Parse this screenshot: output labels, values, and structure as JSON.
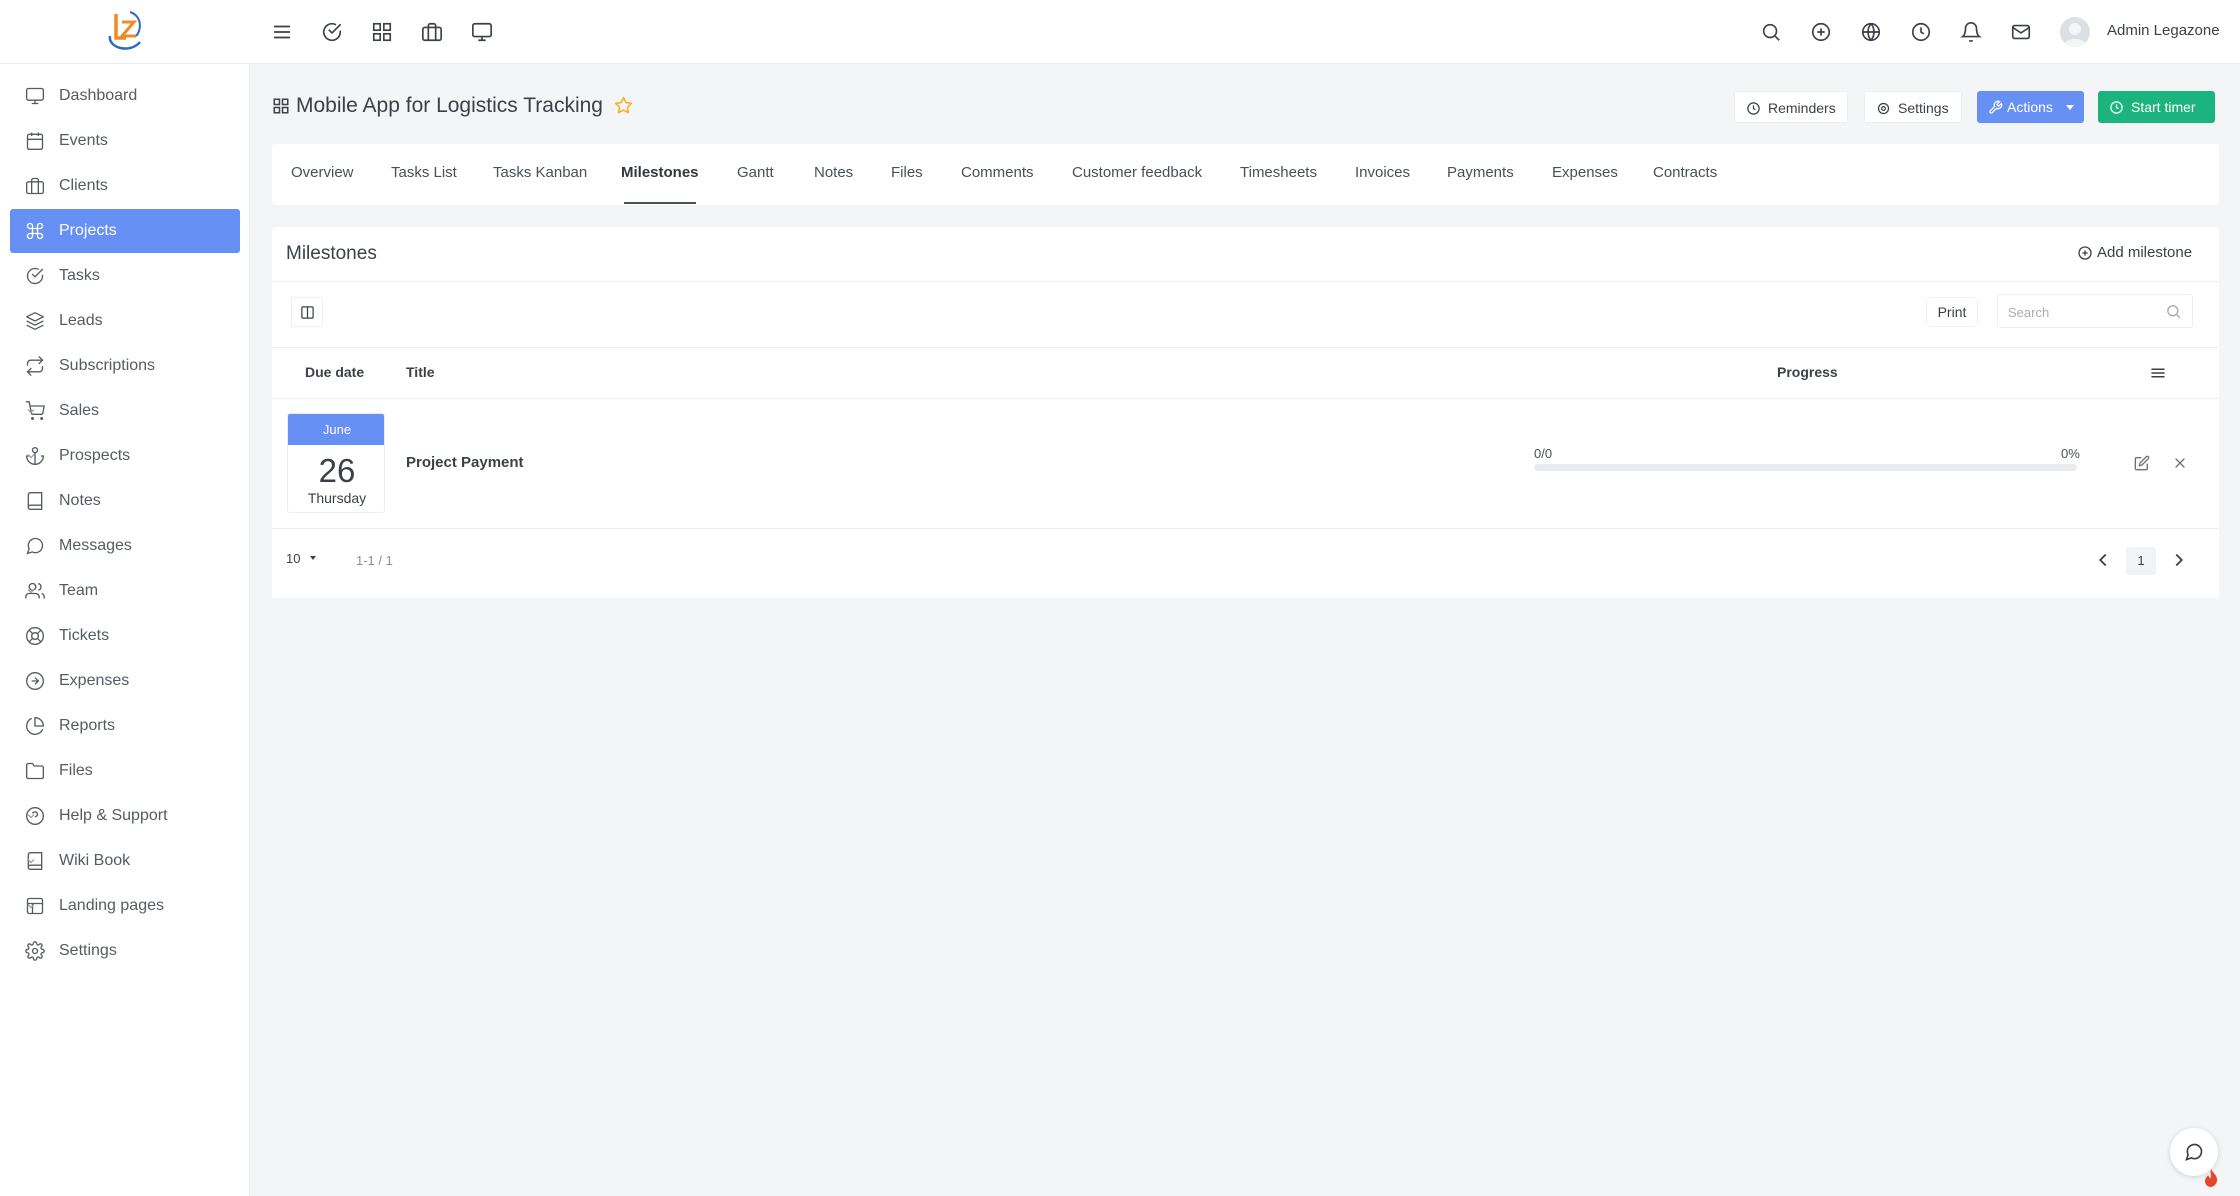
{
  "app": {
    "user_name": "Admin Legazone"
  },
  "sidebar": {
    "items": [
      {
        "label": "Dashboard",
        "icon": "monitor-icon"
      },
      {
        "label": "Events",
        "icon": "calendar-icon"
      },
      {
        "label": "Clients",
        "icon": "briefcase-icon"
      },
      {
        "label": "Projects",
        "icon": "command-icon",
        "active": true
      },
      {
        "label": "Tasks",
        "icon": "check-circle-icon"
      },
      {
        "label": "Leads",
        "icon": "layers-icon"
      },
      {
        "label": "Subscriptions",
        "icon": "repeat-icon"
      },
      {
        "label": "Sales",
        "icon": "cart-icon",
        "has_submenu": true
      },
      {
        "label": "Prospects",
        "icon": "anchor-icon",
        "has_submenu": true
      },
      {
        "label": "Notes",
        "icon": "book-icon"
      },
      {
        "label": "Messages",
        "icon": "message-icon"
      },
      {
        "label": "Team",
        "icon": "users-icon",
        "has_submenu": true
      },
      {
        "label": "Tickets",
        "icon": "life-buoy-icon"
      },
      {
        "label": "Expenses",
        "icon": "arrow-circle-icon"
      },
      {
        "label": "Reports",
        "icon": "pie-chart-icon"
      },
      {
        "label": "Files",
        "icon": "folder-icon"
      },
      {
        "label": "Help & Support",
        "icon": "help-circle-icon",
        "has_submenu": true
      },
      {
        "label": "Wiki Book",
        "icon": "book-open-icon",
        "has_submenu": true
      },
      {
        "label": "Landing pages",
        "icon": "layout-icon",
        "has_submenu": true
      },
      {
        "label": "Settings",
        "icon": "settings-icon"
      }
    ]
  },
  "header": {
    "project_title": "Mobile App for Logistics Tracking",
    "reminders_label": "Reminders",
    "settings_label": "Settings",
    "actions_label": "Actions",
    "start_timer_label": "Start timer"
  },
  "tabs": [
    {
      "label": "Overview"
    },
    {
      "label": "Tasks List"
    },
    {
      "label": "Tasks Kanban"
    },
    {
      "label": "Milestones",
      "active": true
    },
    {
      "label": "Gantt"
    },
    {
      "label": "Notes"
    },
    {
      "label": "Files"
    },
    {
      "label": "Comments"
    },
    {
      "label": "Customer feedback"
    },
    {
      "label": "Timesheets"
    },
    {
      "label": "Invoices"
    },
    {
      "label": "Payments"
    },
    {
      "label": "Expenses"
    },
    {
      "label": "Contracts"
    }
  ],
  "milestones": {
    "title": "Milestones",
    "add_label": "Add milestone",
    "print_label": "Print",
    "search_placeholder": "Search",
    "columns": {
      "due_date": "Due date",
      "title": "Title",
      "progress": "Progress"
    },
    "rows": [
      {
        "month": "June",
        "day": "26",
        "weekday": "Thursday",
        "title": "Project Payment",
        "progress_count": "0/0",
        "progress_percent": "0%",
        "progress_value": 0
      }
    ],
    "footer": {
      "page_size": "10",
      "range": "1-1 / 1",
      "current_page": "1"
    }
  },
  "colors": {
    "primary": "#6690f4",
    "success": "#1cb47e",
    "star": "#f5b027"
  }
}
